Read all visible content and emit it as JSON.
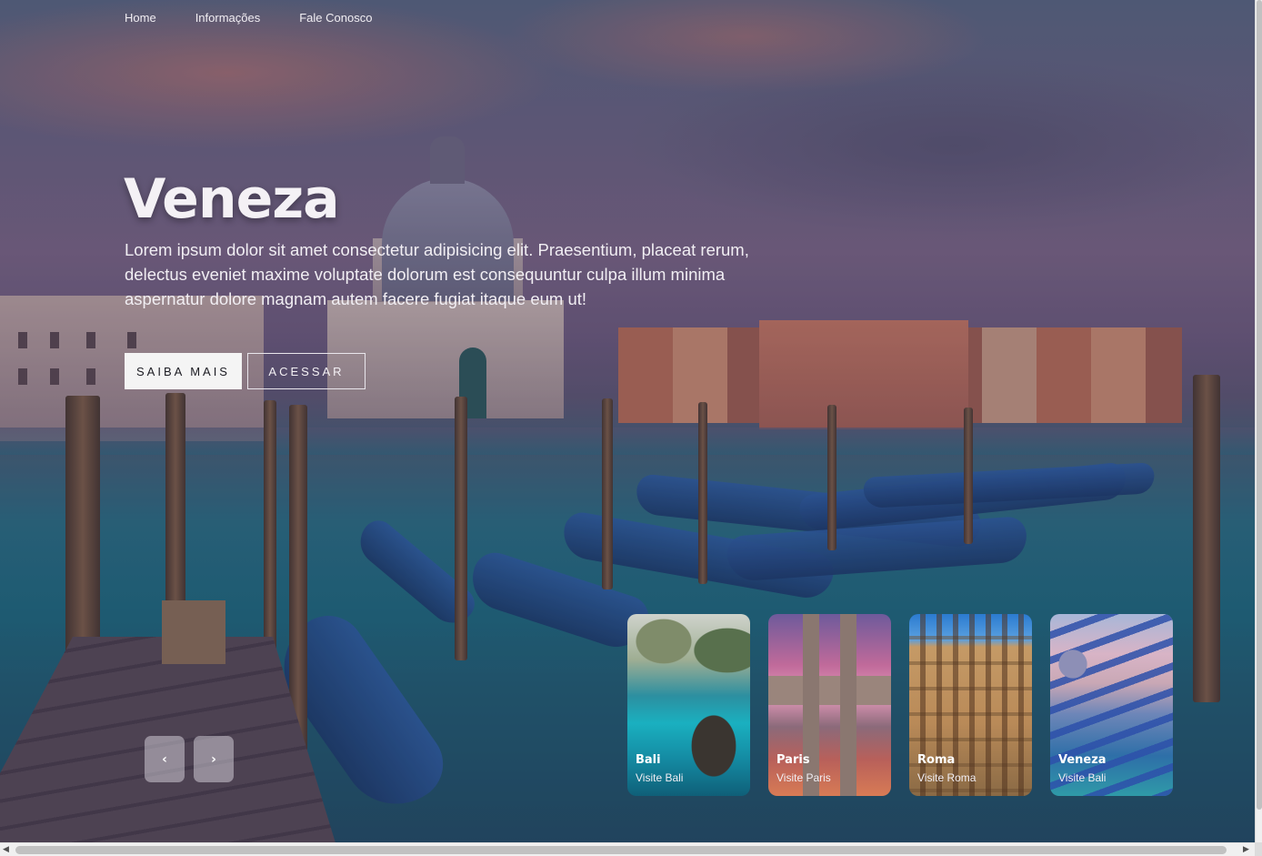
{
  "nav": {
    "items": [
      {
        "label": "Home"
      },
      {
        "label": "Informações"
      },
      {
        "label": "Fale Conosco"
      }
    ]
  },
  "hero": {
    "title": "Veneza",
    "description": "Lorem ipsum dolor sit amet consectetur adipisicing elit. Praesentium, placeat rerum, delectus eveniet maxime voluptate dolorum est consequuntur culpa illum minima aspernatur dolore magnam autem facere fugiat itaque eum ut!",
    "primary_button": "SAIBA MAIS",
    "secondary_button": "ACESSAR"
  },
  "slider": {
    "prev_icon": "chevron-left-icon",
    "next_icon": "chevron-right-icon",
    "prev_glyph": "‹",
    "next_glyph": "›"
  },
  "cards": [
    {
      "title": "Bali",
      "subtitle": "Visite Bali"
    },
    {
      "title": "Paris",
      "subtitle": "Visite Paris"
    },
    {
      "title": "Roma",
      "subtitle": "Visite Roma"
    },
    {
      "title": "Veneza",
      "subtitle": "Visite Bali"
    }
  ],
  "scrollbar": {
    "left_arrow": "◀",
    "right_arrow": "▶"
  }
}
